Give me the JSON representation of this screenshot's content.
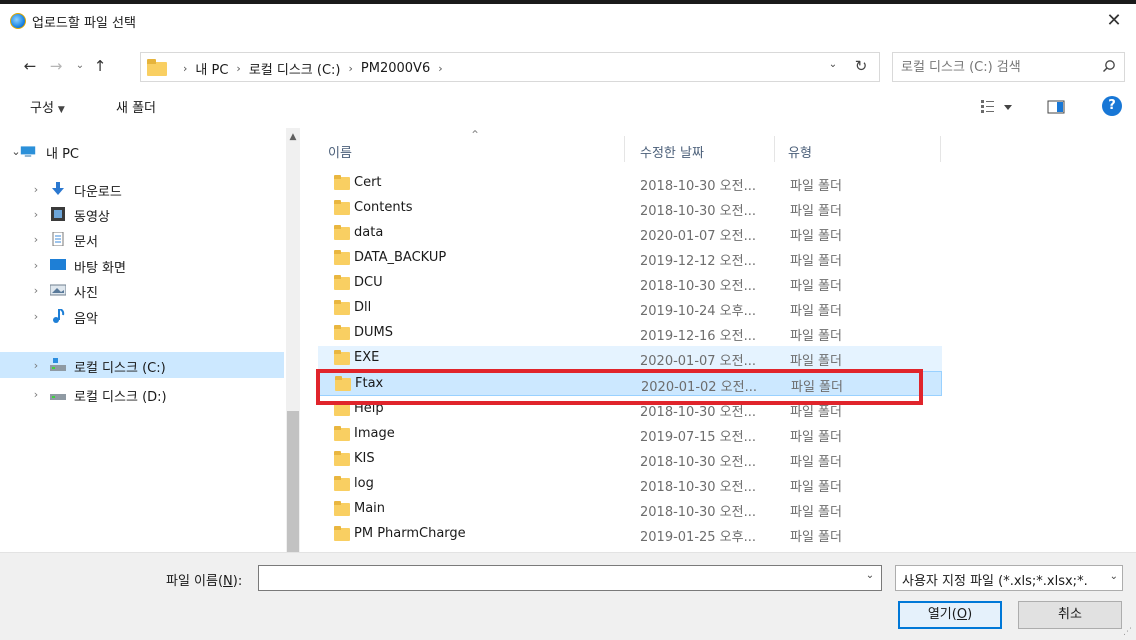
{
  "window": {
    "title": "업로드할 파일 선택",
    "close_label": "✕"
  },
  "address": {
    "crumbs": [
      "내 PC",
      "로컬 디스크 (C:)",
      "PM2000V6"
    ],
    "separator": "›",
    "refresh_glyph": "↻"
  },
  "search": {
    "placeholder": "로컬 디스크 (C:) 검색"
  },
  "toolbar": {
    "organize_label": "구성",
    "new_folder_label": "새 폴더",
    "help_label": "?"
  },
  "nav": {
    "items": [
      {
        "label": "내 PC",
        "icon": "pc-icon",
        "level": "root",
        "expander": "⌄"
      },
      {
        "label": "다운로드",
        "icon": "download-icon",
        "level": "child",
        "expander": "›"
      },
      {
        "label": "동영상",
        "icon": "video-icon",
        "level": "child",
        "expander": "›"
      },
      {
        "label": "문서",
        "icon": "document-icon",
        "level": "child",
        "expander": "›"
      },
      {
        "label": "바탕 화면",
        "icon": "desktop-icon",
        "level": "child",
        "expander": "›"
      },
      {
        "label": "사진",
        "icon": "picture-icon",
        "level": "child",
        "expander": "›"
      },
      {
        "label": "음악",
        "icon": "music-icon",
        "level": "child",
        "expander": "›"
      },
      {
        "label": "로컬 디스크 (C:)",
        "icon": "drive-c-icon",
        "level": "child",
        "expander": "›",
        "selected": true
      },
      {
        "label": "로컬 디스크 (D:)",
        "icon": "drive-d-icon",
        "level": "child",
        "expander": "›"
      }
    ]
  },
  "columns": {
    "name": "이름",
    "date": "수정한 날짜",
    "type": "유형"
  },
  "files": [
    {
      "name": "Cert",
      "date": "2018-10-30 오전...",
      "type": "파일 폴더"
    },
    {
      "name": "Contents",
      "date": "2018-10-30 오전...",
      "type": "파일 폴더"
    },
    {
      "name": "data",
      "date": "2020-01-07 오전...",
      "type": "파일 폴더"
    },
    {
      "name": "DATA_BACKUP",
      "date": "2019-12-12 오전...",
      "type": "파일 폴더"
    },
    {
      "name": "DCU",
      "date": "2018-10-30 오전...",
      "type": "파일 폴더"
    },
    {
      "name": "Dll",
      "date": "2019-10-24 오후...",
      "type": "파일 폴더"
    },
    {
      "name": "DUMS",
      "date": "2019-12-16 오전...",
      "type": "파일 폴더"
    },
    {
      "name": "EXE",
      "date": "2020-01-07 오전...",
      "type": "파일 폴더"
    },
    {
      "name": "Ftax",
      "date": "2020-01-02 오전...",
      "type": "파일 폴더"
    },
    {
      "name": "Help",
      "date": "2018-10-30 오전...",
      "type": "파일 폴더"
    },
    {
      "name": "Image",
      "date": "2019-07-15 오전...",
      "type": "파일 폴더"
    },
    {
      "name": "KIS",
      "date": "2018-10-30 오전...",
      "type": "파일 폴더"
    },
    {
      "name": "log",
      "date": "2018-10-30 오전...",
      "type": "파일 폴더"
    },
    {
      "name": "Main",
      "date": "2018-10-30 오전...",
      "type": "파일 폴더"
    },
    {
      "name": "PM PharmCharge",
      "date": "2019-01-25 오후...",
      "type": "파일 폴더"
    }
  ],
  "selected_file": "Ftax",
  "bottom": {
    "filename_label_prefix": "파일 이름(",
    "filename_label_key": "N",
    "filename_label_suffix": "):",
    "filename_value": "",
    "filter_value": "사용자 지정 파일 (*.xls;*.xlsx;*.",
    "open_prefix": "열기(",
    "open_key": "O",
    "open_suffix": ")",
    "cancel_label": "취소"
  },
  "colors": {
    "selection": "#cce8ff",
    "highlight_border": "#e0242b",
    "accent": "#0078d7",
    "folder": "#f9cf62"
  }
}
